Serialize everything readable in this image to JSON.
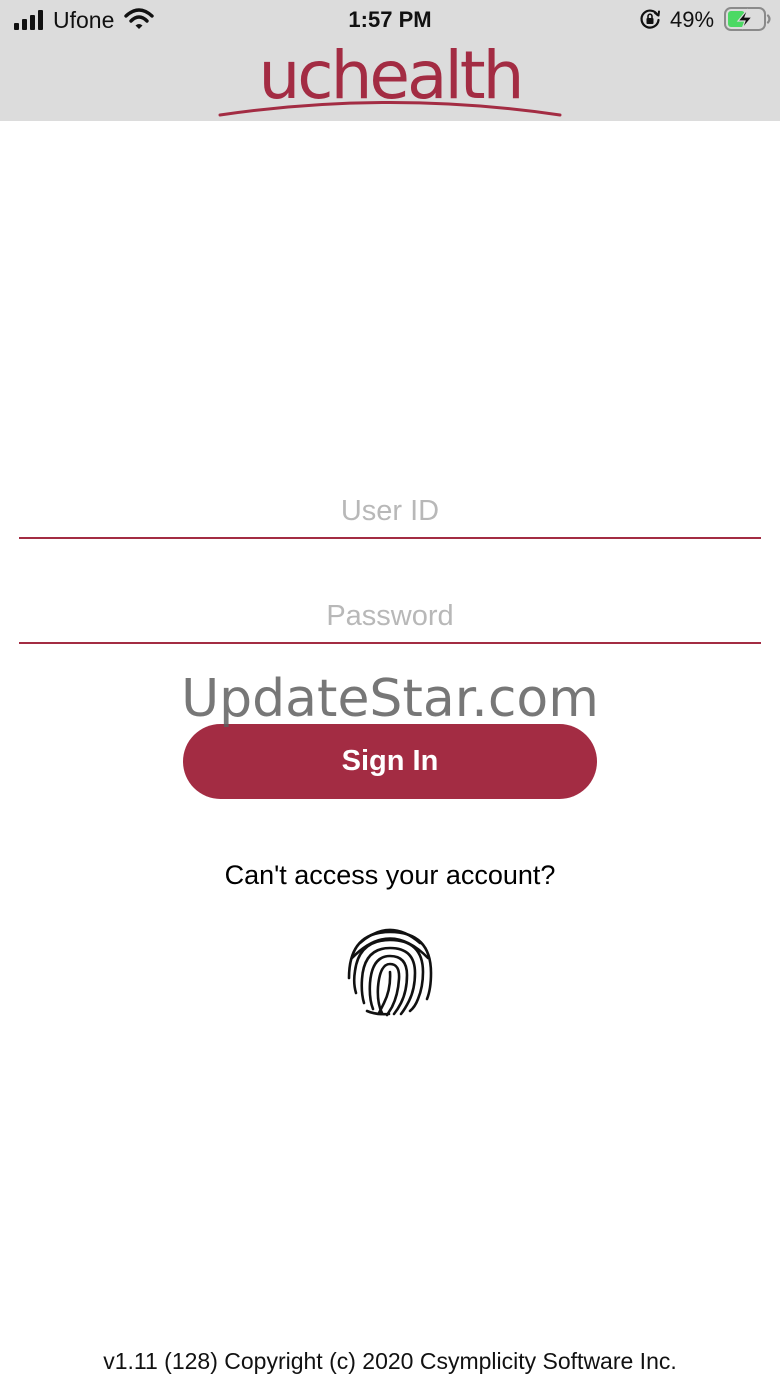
{
  "status_bar": {
    "carrier": "Ufone",
    "time": "1:57 PM",
    "battery_percent": "49%",
    "battery_level": 0.49,
    "charging": true,
    "icons": [
      "signal-icon",
      "wifi-icon",
      "orientation-lock-icon",
      "battery-charging-icon"
    ]
  },
  "header": {
    "logo_text": "uchealth"
  },
  "login": {
    "user_id_placeholder": "User ID",
    "password_placeholder": "Password",
    "sign_in_label": "Sign In",
    "help_link": "Can't access your account?",
    "biometric_icon": "fingerprint-icon"
  },
  "watermark": "UpdateStar.com",
  "footer": {
    "version_text": "v1.11 (128) Copyright (c) 2020 Csymplicity Software Inc."
  },
  "colors": {
    "brand": "#a32c43",
    "header_bg": "#dcdcdc",
    "placeholder": "#b8b8b8",
    "battery_fill": "#4cd964"
  }
}
